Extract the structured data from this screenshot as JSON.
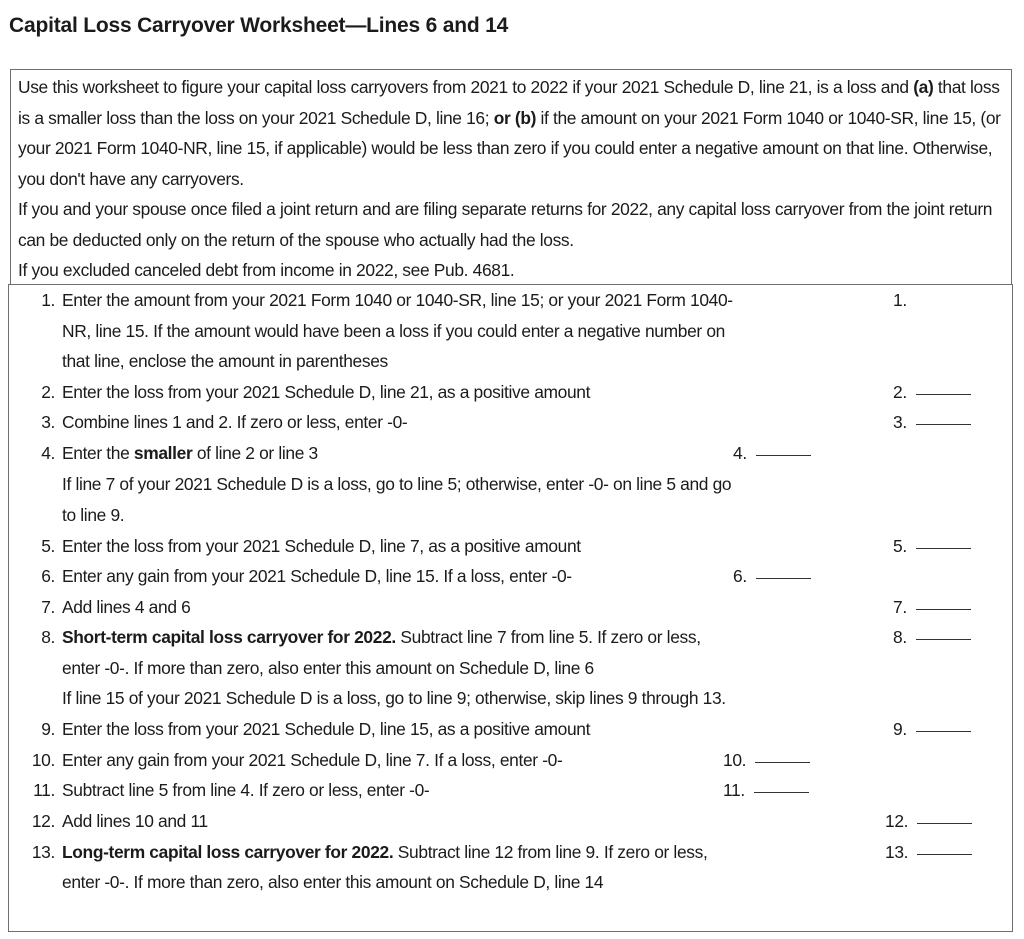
{
  "title": "Capital Loss Carryover Worksheet—Lines 6 and 14",
  "intro": {
    "p1": {
      "pre_a": "Use this worksheet to figure your capital loss carryovers from 2021 to 2022 if your 2021 Schedule D, line 21, is a loss and ",
      "a_label": "(a)",
      "after_a": " that loss is a smaller loss than the loss on your 2021 Schedule D, line 16; ",
      "or_b_label": "or (b)",
      "after_b": " if the amount on your 2021 Form 1040 or 1040-SR, line 15, (or your 2021 Form 1040-NR, line 15, if applicable) would be less than zero if you could enter a negative amount on that line. Otherwise, you don't have any carryovers."
    },
    "p2": "If you and your spouse once filed a joint return and are filing separate returns for 2022, any capital loss carryover from the joint return can be deducted only on the return of the spouse who actually had the loss.",
    "p3": "If you excluded canceled debt from income in 2022, see Pub. 4681."
  },
  "lines": {
    "l1": {
      "num": "1.",
      "text1": "Enter the amount from your 2021 Form 1040 or 1040-SR, line 15; or your 2021 Form 1040-",
      "text2": "NR, line 15. If the amount would have been a loss if you could enter a negative number on",
      "text3": "that line, enclose the amount in parentheses",
      "ref": "1.",
      "value": ""
    },
    "l2": {
      "num": "2.",
      "text": "Enter the loss from your 2021 Schedule D, line 21, as a positive amount",
      "ref": "2.",
      "value": ""
    },
    "l3": {
      "num": "3.",
      "text": "Combine lines 1 and 2. If zero or less, enter -0-",
      "ref": "3.",
      "value": ""
    },
    "l4": {
      "num": "4.",
      "pre": "Enter the ",
      "bold": "smaller",
      "post": " of line 2 or line 3",
      "ref": "4.",
      "value": ""
    },
    "note1": {
      "text1": "If line 7 of your 2021 Schedule D is a loss, go to line 5; otherwise, enter -0- on line 5 and go",
      "text2": "to line 9."
    },
    "l5": {
      "num": "5.",
      "text": "Enter the loss from your 2021 Schedule D, line 7, as a positive amount",
      "ref": "5.",
      "value": ""
    },
    "l6": {
      "num": "6.",
      "text": "Enter any gain from your 2021 Schedule D, line 15. If a loss, enter -0-",
      "ref": "6.",
      "value": ""
    },
    "l7": {
      "num": "7.",
      "text": "Add lines 4 and 6",
      "ref": "7.",
      "value": ""
    },
    "l8": {
      "num": "8.",
      "bold": "Short-term capital loss carryover for 2022.",
      "post": " Subtract line 7 from line 5. If zero or less,",
      "text2": "enter -0-. If more than zero, also enter this amount on Schedule D, line 6",
      "ref": "8.",
      "value": ""
    },
    "note2": {
      "text": "If line 15 of your 2021 Schedule D is a loss, go to line 9; otherwise, skip lines 9 through 13."
    },
    "l9": {
      "num": "9.",
      "text": "Enter the loss from your 2021 Schedule D, line 15, as a positive amount",
      "ref": "9.",
      "value": ""
    },
    "l10": {
      "num": "10.",
      "text": "Enter any gain from your 2021 Schedule D, line 7. If a loss, enter -0-",
      "ref": "10.",
      "value": ""
    },
    "l11": {
      "num": "11.",
      "text": "Subtract line 5 from line 4. If zero or less, enter -0-",
      "ref": "11.",
      "value": ""
    },
    "l12": {
      "num": "12.",
      "text": "Add lines 10 and 11",
      "ref": "12.",
      "value": ""
    },
    "l13": {
      "num": "13.",
      "bold": "Long-term capital loss carryover for 2022.",
      "post": " Subtract line 12 from line 9. If zero or less,",
      "text2": "enter -0-. If more than zero, also enter this amount on Schedule D, line 14",
      "ref": "13.",
      "value": ""
    }
  }
}
